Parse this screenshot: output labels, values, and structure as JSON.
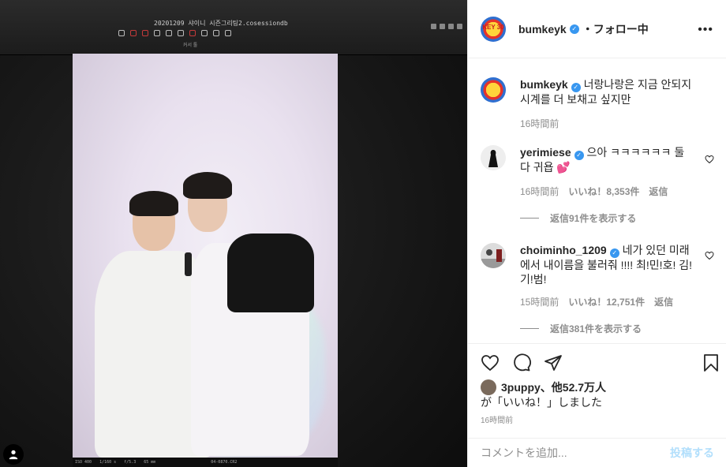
{
  "photo": {
    "monitor_title": "20201209 샤이니 시즌그리팅2.cosessiondb",
    "tool_caption": "커서 툴",
    "status": [
      "ISO 400",
      "1/160 s",
      "f/5.3",
      "65 mm",
      "04-0870.CR2"
    ]
  },
  "header": {
    "username": "bumkeyk",
    "avatar_text": "KEY 30",
    "follow": "・フォロー中",
    "more": "•••"
  },
  "caption": {
    "username": "bumkeyk",
    "text": "너랑나랑은 지금 안되지 시계를 더 보채고 싶지만",
    "time": "16時間前"
  },
  "comments": [
    {
      "username": "yerimiese",
      "text": "으아 ㅋㅋㅋㅋㅋㅋ 둘다 귀욥 💕",
      "time": "16時間前",
      "likes": "いいね！8,353件",
      "reply": "返信",
      "view_replies": "返信91件を表示する"
    },
    {
      "username": "choiminho_1209",
      "text": "네가 있던 미래에서 내이름을 불러줘 !!!! 최!민!호! 김!기!범!",
      "time": "15時間前",
      "likes": "いいね！12,751件",
      "reply": "返信",
      "view_replies": "返信381件を表示する"
    }
  ],
  "likes": {
    "user": "3puppy",
    "others": "、他52.7万人",
    "suffix": "が「いいね！」しました"
  },
  "post_time": "16時間前",
  "add_comment": {
    "placeholder": "コメントを追加...",
    "post_label": "投稿する"
  },
  "colors": {
    "verified": "#3897f0",
    "muted": "#8e8e8e",
    "post_button": "#b2dffc"
  }
}
